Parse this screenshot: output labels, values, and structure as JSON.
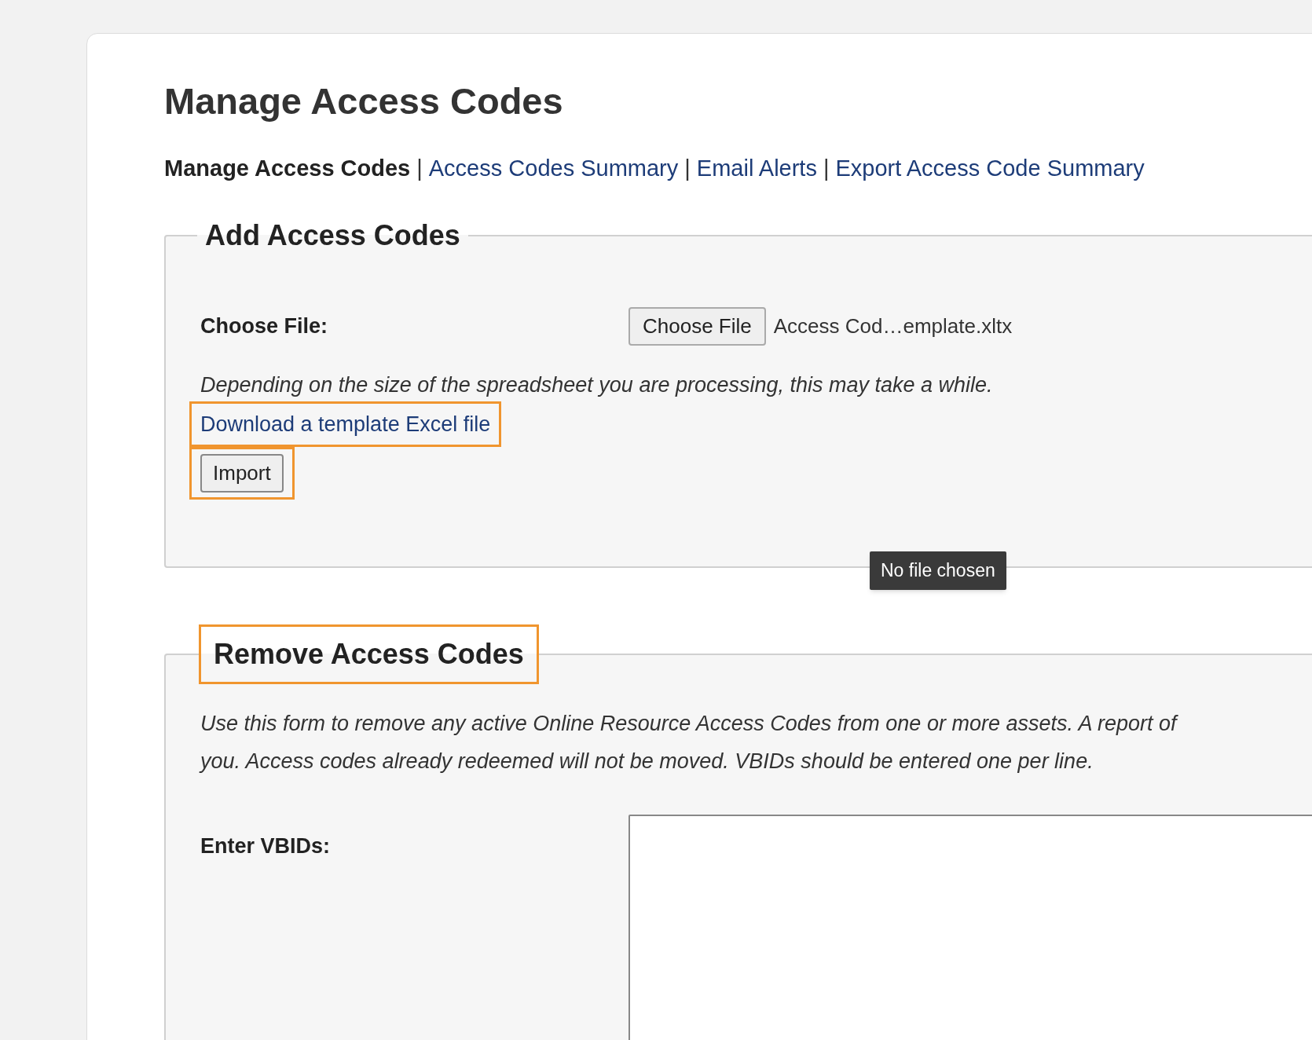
{
  "page": {
    "title": "Manage Access Codes"
  },
  "nav": [
    {
      "label": "Manage Access Codes",
      "selected": true
    },
    {
      "label": "Access Codes Summary",
      "selected": false
    },
    {
      "label": "Email Alerts",
      "selected": false
    },
    {
      "label": "Export Access Code Summary",
      "selected": false
    }
  ],
  "nav_separator": "|",
  "add_section": {
    "legend": "Add Access Codes",
    "legend_highlighted": false,
    "file_label": "Choose File:",
    "file_button": "Choose File",
    "file_name": "Access Cod…emplate.xltx",
    "note": "Depending on the size of the spreadsheet you are processing, this may take a while.",
    "template_link": {
      "label": "Download a template Excel file",
      "highlighted": true
    },
    "import_button": {
      "label": "Import",
      "highlighted": true
    },
    "tooltip": "No file chosen"
  },
  "remove_section": {
    "legend": "Remove Access Codes",
    "legend_highlighted": true,
    "description_lines": [
      "Use this form to remove any active Online Resource Access Codes from one or more assets. A report of",
      "you. Access codes already redeemed will not be moved. VBIDs should be entered one per line."
    ],
    "vbids_label": "Enter VBIDs:"
  }
}
